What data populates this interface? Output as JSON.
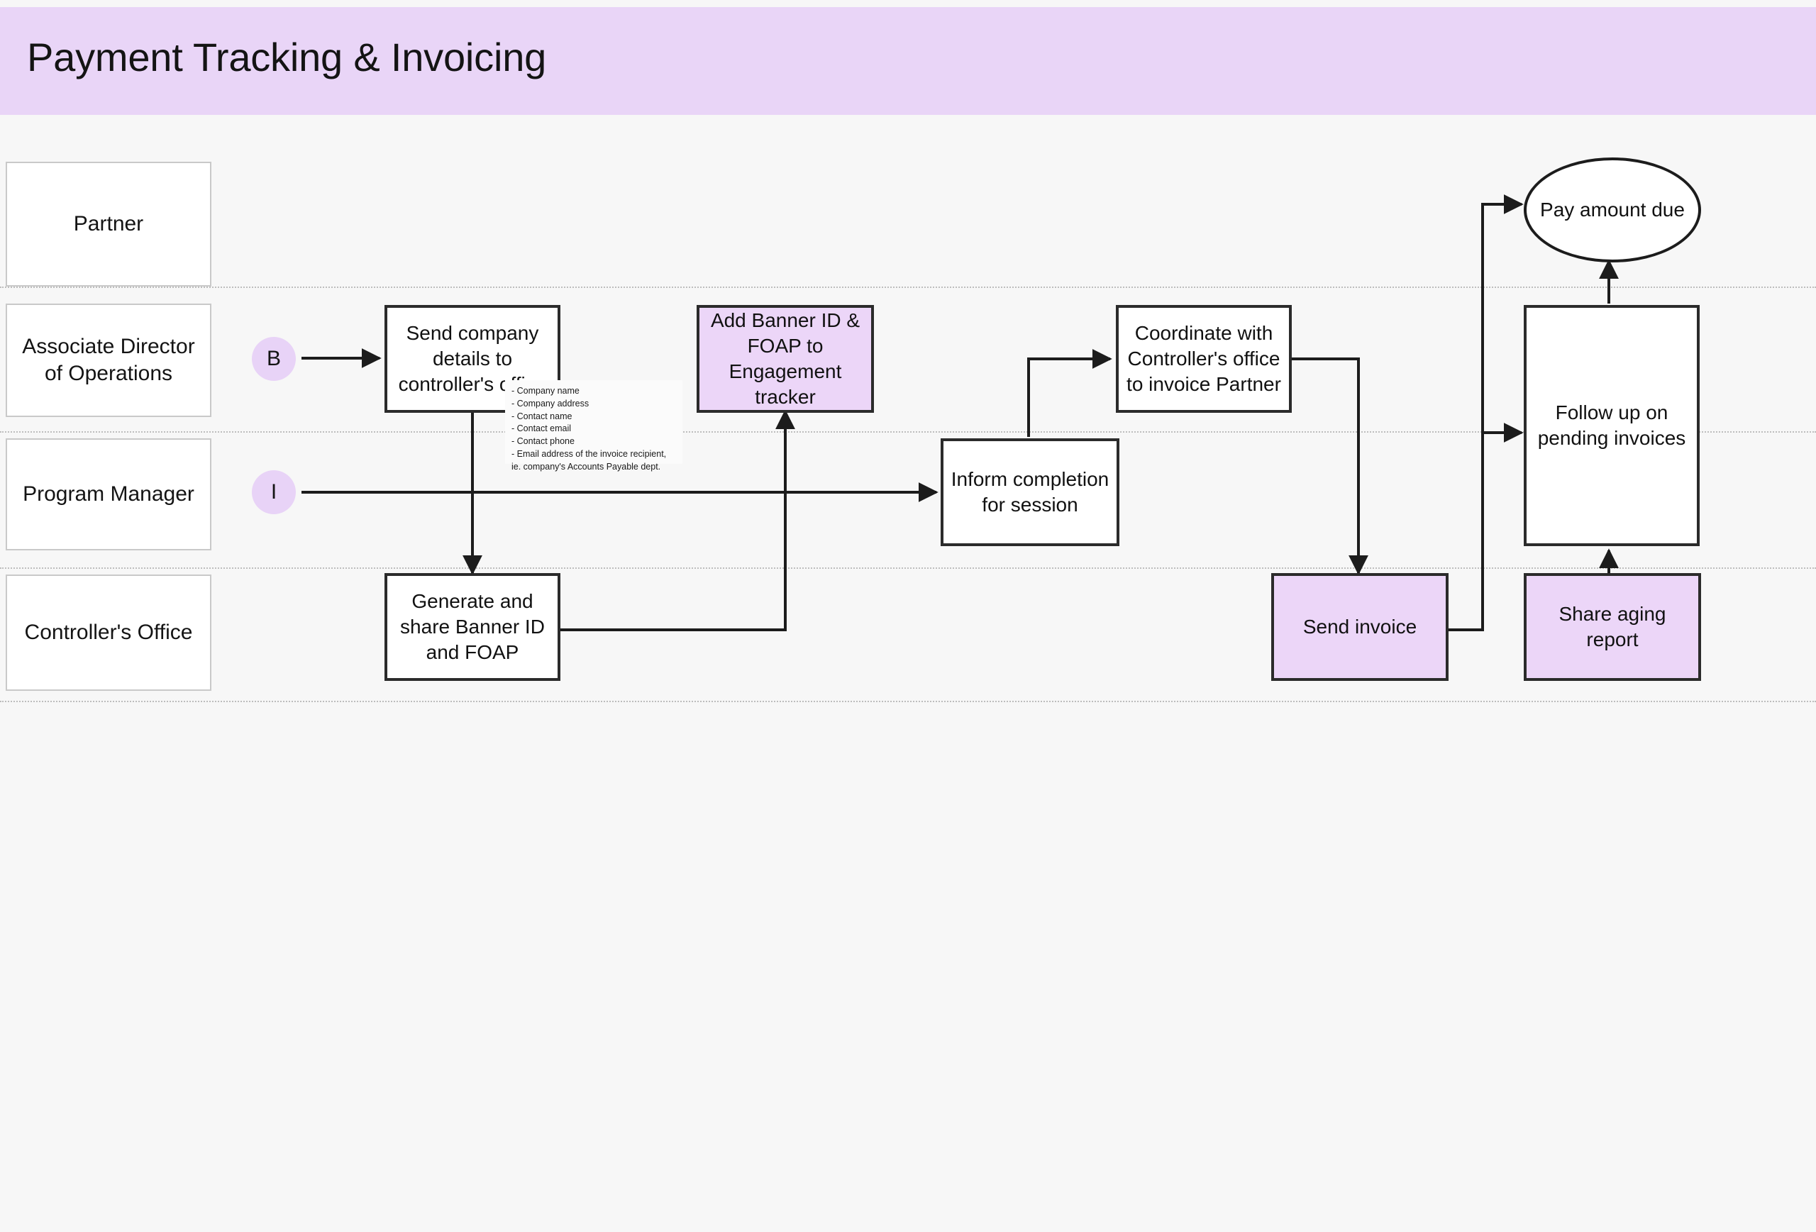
{
  "header": {
    "title": "Payment Tracking & Invoicing",
    "banner_color": "#e9d5f7"
  },
  "colors": {
    "accent_fill": "#ecd6f8",
    "node_border": "#2b2b2b",
    "canvas_bg": "#f7f7f7",
    "lane_border": "#c9c9c9",
    "badge_fill": "#e8d3f7"
  },
  "lanes": [
    {
      "label": "Partner"
    },
    {
      "label": "Associate Director\nof Operations"
    },
    {
      "label": "Program Manager"
    },
    {
      "label": "Controller's Office"
    }
  ],
  "badges": [
    {
      "label": "B",
      "lane": "Associate Director of Operations"
    },
    {
      "label": "I",
      "lane": "Program Manager"
    }
  ],
  "nodes": [
    {
      "id": "send-company-details",
      "label": "Send company details to controller's office",
      "shape": "process",
      "fill": "white",
      "lane": "Associate Director of Operations"
    },
    {
      "id": "add-banner-id-foap",
      "label": "Add Banner ID & FOAP to Engagement tracker",
      "shape": "process",
      "fill": "accent",
      "lane": "Associate Director of Operations"
    },
    {
      "id": "coordinate-controller-office",
      "label": "Coordinate with Controller's office to invoice Partner",
      "shape": "process",
      "fill": "white",
      "lane": "Associate Director of Operations"
    },
    {
      "id": "follow-up-pending-invoices",
      "label": "Follow up on pending invoices",
      "shape": "process",
      "fill": "white",
      "lane": "Associate Director of Operations"
    },
    {
      "id": "pay-amount-due",
      "label": "Pay amount due",
      "shape": "terminator",
      "fill": "white",
      "lane": "Partner"
    },
    {
      "id": "inform-completion-session",
      "label": "Inform completion for session",
      "shape": "process",
      "fill": "white",
      "lane": "Program Manager"
    },
    {
      "id": "generate-share-banner-id",
      "label": "Generate and share Banner ID and FOAP",
      "shape": "process",
      "fill": "white",
      "lane": "Controller's Office"
    },
    {
      "id": "send-invoice",
      "label": "Send invoice",
      "shape": "process",
      "fill": "accent",
      "lane": "Controller's Office"
    },
    {
      "id": "share-aging-report",
      "label": "Share aging report",
      "shape": "process",
      "fill": "accent",
      "lane": "Controller's Office"
    }
  ],
  "annotation": {
    "id": "company-details-note",
    "text": "- Company name\n- Company address\n- Contact name\n- Contact email\n- Contact phone\n- Email address of the invoice recipient, ie. company's Accounts Payable dept."
  }
}
